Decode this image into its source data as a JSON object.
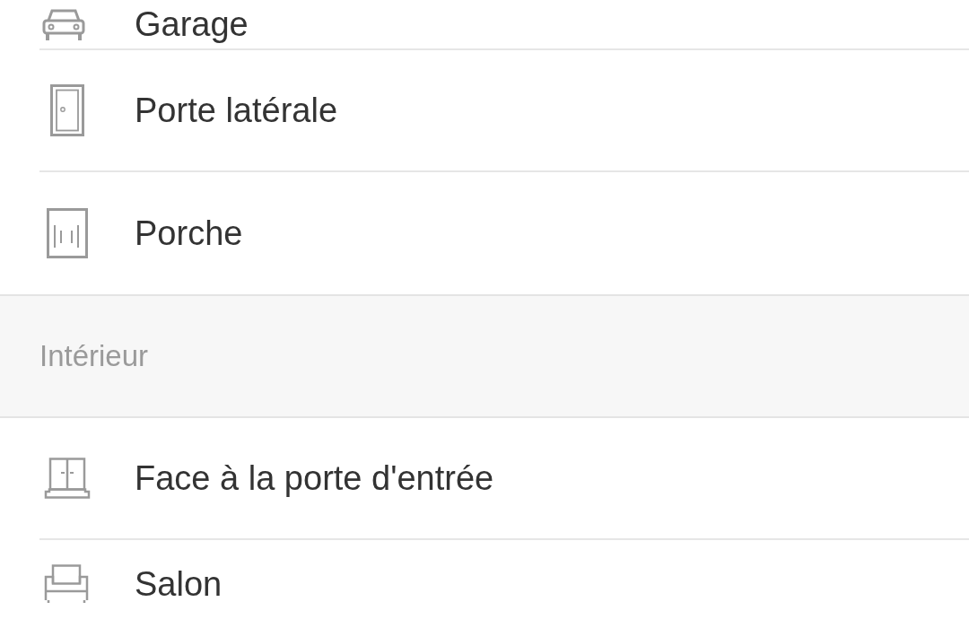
{
  "sections": [
    {
      "items": [
        {
          "label": "Garage",
          "kind": "car"
        },
        {
          "label": "Porte latérale",
          "kind": "door"
        },
        {
          "label": "Porche",
          "kind": "panel"
        }
      ]
    },
    {
      "header": "Intérieur",
      "items": [
        {
          "label": "Face à la porte d'entrée",
          "kind": "window"
        },
        {
          "label": "Salon",
          "kind": "sofa"
        }
      ]
    }
  ]
}
